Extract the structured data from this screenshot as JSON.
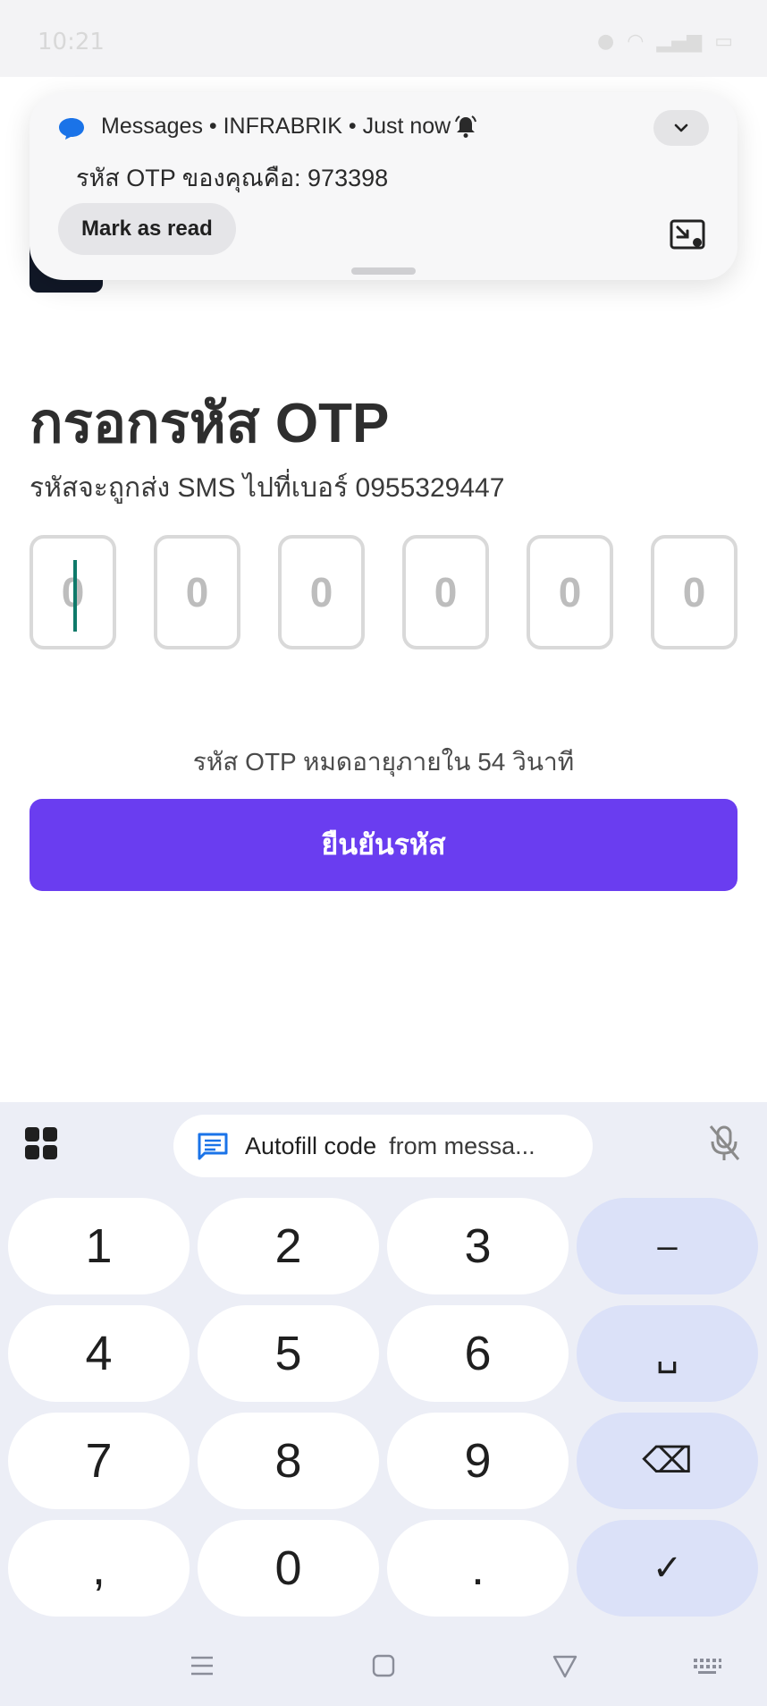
{
  "status_bar": {
    "time": "10:21"
  },
  "notification": {
    "header": "Messages • INFRABRIK • Just now",
    "body": "รหัส OTP ของคุณคือ: 973398",
    "action_label": "Mark as read"
  },
  "main": {
    "title": "กรอกรหัส OTP",
    "subtitle": "รหัสจะถูกส่ง SMS ไปที่เบอร์ 0955329447",
    "otp_placeholders": [
      "0",
      "0",
      "0",
      "0",
      "0",
      "0"
    ],
    "expire_text": "รหัส OTP หมดอายุภายใน 54 วินาที",
    "confirm_label": "ยืนยันรหัส"
  },
  "keyboard": {
    "autofill_label": "Autofill code",
    "autofill_source": "from messa...",
    "keys": [
      [
        "1",
        "2",
        "3",
        "–"
      ],
      [
        "4",
        "5",
        "6",
        "␣"
      ],
      [
        "7",
        "8",
        "9",
        "⌫"
      ],
      [
        ",",
        "0",
        ".",
        "✓"
      ]
    ]
  },
  "colors": {
    "accent": "#6a3df0",
    "caret": "#0f7a6a",
    "keyboard_bg": "#eceef6",
    "function_key": "#dbe1f8"
  }
}
